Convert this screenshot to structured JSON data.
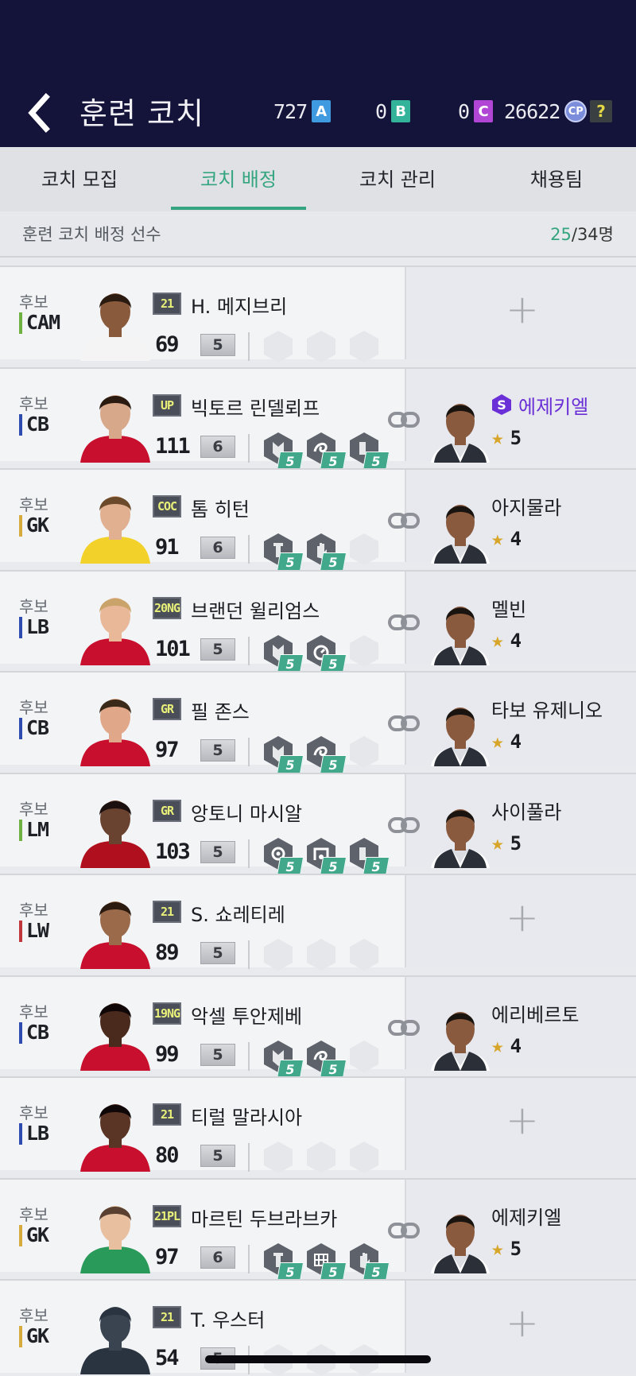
{
  "header": {
    "title": "훈련 코치",
    "currencies": [
      {
        "value": "727",
        "badge": "A",
        "color": "#3f9ae0"
      },
      {
        "value": "0",
        "badge": "B",
        "color": "#33b39a"
      },
      {
        "value": "0",
        "badge": "C",
        "color": "#b146d6"
      },
      {
        "value": "26622",
        "badge": "CP",
        "color": "#7c8ddb"
      }
    ],
    "help": "?"
  },
  "tabs": [
    {
      "label": "코치 모집",
      "active": false
    },
    {
      "label": "코치 배정",
      "active": true
    },
    {
      "label": "코치 관리",
      "active": false
    },
    {
      "label": "채용팀",
      "active": false
    }
  ],
  "subheader": {
    "label": "훈련 코치 배정 선수",
    "assigned": "25",
    "total": "/34명"
  },
  "colors": {
    "accent": "#34a57f",
    "pos_cam": "#6fb141",
    "pos_def": "#2e4bb0",
    "pos_gk": "#d6aa3c",
    "pos_fwd": "#c0363a"
  },
  "players": [
    {
      "role": "후보",
      "pos": "CAM",
      "pos_color": "#6fb141",
      "season": "21",
      "name": "H. 메지브리",
      "ovr": "69",
      "grade": "5",
      "skills": [],
      "coach": null,
      "skin": "#8a5a3c",
      "kit": "#f4f4f4",
      "hair": "#2a1a10"
    },
    {
      "role": "후보",
      "pos": "CB",
      "pos_color": "#2e4bb0",
      "season": "UP",
      "name": "빅토르 린델뢰프",
      "ovr": "111",
      "grade": "6",
      "skills": [
        {
          "icon": "shield-icon",
          "lvl": "5"
        },
        {
          "icon": "swirl-icon",
          "lvl": "5"
        },
        {
          "icon": "boot-icon",
          "lvl": "5"
        }
      ],
      "coach": {
        "name": "에제키엘",
        "stars": "5",
        "special": true,
        "badge": "S"
      },
      "skin": "#d8a88a",
      "kit": "#c8102e",
      "hair": "#2a1a10"
    },
    {
      "role": "후보",
      "pos": "GK",
      "pos_color": "#d6aa3c",
      "season": "COC",
      "name": "톰 히턴",
      "ovr": "91",
      "grade": "6",
      "skills": [
        {
          "icon": "tower-icon",
          "lvl": "5"
        },
        {
          "icon": "glove-icon",
          "lvl": "5"
        }
      ],
      "coach": {
        "name": "아지물라",
        "stars": "4",
        "special": false
      },
      "skin": "#e0b090",
      "kit": "#f2d22a",
      "hair": "#6a4a2a"
    },
    {
      "role": "후보",
      "pos": "LB",
      "pos_color": "#2e4bb0",
      "season": "20NG",
      "name": "브랜던 윌리엄스",
      "ovr": "101",
      "grade": "5",
      "skills": [
        {
          "icon": "shield-icon",
          "lvl": "5"
        },
        {
          "icon": "stopwatch-icon",
          "lvl": "5"
        }
      ],
      "coach": {
        "name": "멜빈",
        "stars": "4",
        "special": false
      },
      "skin": "#e8b898",
      "kit": "#c8102e",
      "hair": "#c9a36a"
    },
    {
      "role": "후보",
      "pos": "CB",
      "pos_color": "#2e4bb0",
      "season": "GR",
      "name": "필 존스",
      "ovr": "97",
      "grade": "5",
      "skills": [
        {
          "icon": "shield-icon",
          "lvl": "5"
        },
        {
          "icon": "swirl-icon",
          "lvl": "5"
        }
      ],
      "coach": {
        "name": "타보 유제니오",
        "stars": "4",
        "special": false
      },
      "skin": "#e0a888",
      "kit": "#c8102e",
      "hair": "#3a2a1a"
    },
    {
      "role": "후보",
      "pos": "LM",
      "pos_color": "#6fb141",
      "season": "GR",
      "name": "앙토니 마시알",
      "ovr": "103",
      "grade": "5",
      "skills": [
        {
          "icon": "eye-icon",
          "lvl": "5"
        },
        {
          "icon": "goal-icon",
          "lvl": "5"
        },
        {
          "icon": "boot-icon",
          "lvl": "5"
        }
      ],
      "coach": {
        "name": "사이풀라",
        "stars": "5",
        "special": false
      },
      "skin": "#6a4230",
      "kit": "#b0101e",
      "hair": "#1a1010"
    },
    {
      "role": "후보",
      "pos": "LW",
      "pos_color": "#c0363a",
      "season": "21",
      "name": "S. 쇼레티레",
      "ovr": "89",
      "grade": "5",
      "skills": [],
      "coach": null,
      "skin": "#9a6a4a",
      "kit": "#c8102e",
      "hair": "#2a1a10"
    },
    {
      "role": "후보",
      "pos": "CB",
      "pos_color": "#2e4bb0",
      "season": "19NG",
      "name": "악셀 투안제베",
      "ovr": "99",
      "grade": "5",
      "skills": [
        {
          "icon": "shield-icon",
          "lvl": "5"
        },
        {
          "icon": "swirl-icon",
          "lvl": "5"
        }
      ],
      "coach": {
        "name": "에리베르토",
        "stars": "4",
        "special": false
      },
      "skin": "#4a2a1c",
      "kit": "#c8102e",
      "hair": "#100808"
    },
    {
      "role": "후보",
      "pos": "LB",
      "pos_color": "#2e4bb0",
      "season": "21",
      "name": "티럴 말라시아",
      "ovr": "80",
      "grade": "5",
      "skills": [],
      "coach": null,
      "skin": "#5a3424",
      "kit": "#c8102e",
      "hair": "#100808"
    },
    {
      "role": "후보",
      "pos": "GK",
      "pos_color": "#d6aa3c",
      "season": "21PL",
      "name": "마르틴 두브라브카",
      "ovr": "97",
      "grade": "6",
      "skills": [
        {
          "icon": "tower-icon",
          "lvl": "5"
        },
        {
          "icon": "net-icon",
          "lvl": "5"
        },
        {
          "icon": "glove-icon",
          "lvl": "5"
        }
      ],
      "coach": {
        "name": "에제키엘",
        "stars": "5",
        "special": false
      },
      "skin": "#e8c0a0",
      "kit": "#2a9a5a",
      "hair": "#5a4030"
    },
    {
      "role": "후보",
      "pos": "GK",
      "pos_color": "#d6aa3c",
      "season": "21",
      "name": "T. 우스터",
      "ovr": "54",
      "grade": "5",
      "skills": [],
      "coach": null,
      "skin": "#3a4450",
      "kit": "#2a3440",
      "hair": "#2a3440"
    }
  ]
}
